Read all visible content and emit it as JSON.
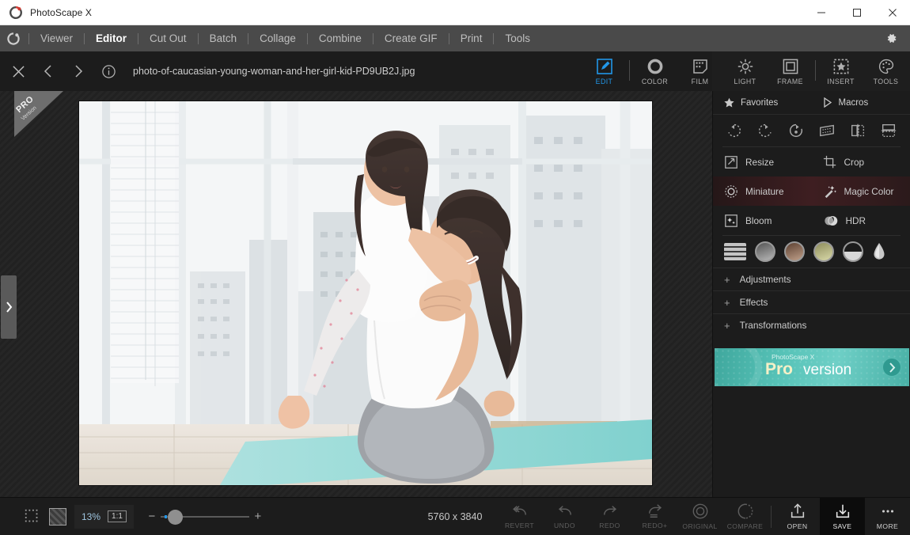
{
  "window": {
    "title": "PhotoScape X",
    "logo_icon": "photoscape-logo-icon",
    "minimize_icon": "minimize-icon",
    "maximize_icon": "maximize-icon",
    "close_icon": "close-icon"
  },
  "menubar": {
    "logo_icon": "photoscape-mark-icon",
    "items": [
      {
        "label": "Viewer",
        "active": false
      },
      {
        "label": "Editor",
        "active": true
      },
      {
        "label": "Cut Out",
        "active": false
      },
      {
        "label": "Batch",
        "active": false
      },
      {
        "label": "Collage",
        "active": false
      },
      {
        "label": "Combine",
        "active": false
      },
      {
        "label": "Create GIF",
        "active": false
      },
      {
        "label": "Print",
        "active": false
      },
      {
        "label": "Tools",
        "active": false
      }
    ],
    "settings_icon": "gear-icon"
  },
  "filebar": {
    "close_icon": "close-icon",
    "prev_icon": "chevron-left-icon",
    "next_icon": "chevron-right-icon",
    "info_icon": "info-icon",
    "filename": "photo-of-caucasian-young-woman-and-her-girl-kid-PD9UB2J.jpg"
  },
  "edit_tabs": [
    {
      "label": "EDIT",
      "icon": "edit-pencil-icon",
      "selected": true
    },
    {
      "label": "COLOR",
      "icon": "color-ring-icon",
      "selected": false
    },
    {
      "label": "FILM",
      "icon": "film-icon",
      "selected": false
    },
    {
      "label": "LIGHT",
      "icon": "light-sun-icon",
      "selected": false
    },
    {
      "label": "FRAME",
      "icon": "frame-square-icon",
      "selected": false
    },
    {
      "label": "INSERT",
      "icon": "insert-star-icon",
      "selected": false
    },
    {
      "label": "TOOLS",
      "icon": "tools-palette-icon",
      "selected": false
    }
  ],
  "canvas": {
    "pro_ribbon_line1": "PRO",
    "pro_ribbon_line2": "Version",
    "left_handle_icon": "chevron-right-icon"
  },
  "right_panel": {
    "favorites": {
      "label": "Favorites",
      "icon": "star-icon"
    },
    "macros": {
      "label": "Macros",
      "icon": "play-triangle-icon"
    },
    "transform_icons": [
      "rotate-left-icon",
      "rotate-right-icon",
      "free-rotate-icon",
      "skew-icon",
      "flip-horizontal-icon",
      "flip-vertical-icon"
    ],
    "tools": [
      [
        {
          "label": "Resize",
          "icon": "resize-icon",
          "highlighted": false
        },
        {
          "label": "Crop",
          "icon": "crop-icon",
          "highlighted": false
        }
      ],
      [
        {
          "label": "Miniature",
          "icon": "miniature-icon",
          "highlighted": true
        },
        {
          "label": "Magic Color",
          "icon": "magic-wand-icon",
          "highlighted": true
        }
      ],
      [
        {
          "label": "Bloom",
          "icon": "bloom-icon",
          "highlighted": false
        },
        {
          "label": "HDR",
          "icon": "hdr-icon",
          "highlighted": false
        }
      ]
    ],
    "filters": [
      {
        "name": "filter-list-icon",
        "color": "#c4c4c4"
      },
      {
        "name": "filter-grayscale-swatch",
        "color": "#8f9296"
      },
      {
        "name": "filter-sepia-swatch",
        "color": "#9c7a63"
      },
      {
        "name": "filter-vintage-swatch",
        "color": "#c7c79a"
      },
      {
        "name": "filter-vignette-swatch",
        "color": "#d8d8d8"
      },
      {
        "name": "filter-blur-drop-icon",
        "color": "#cfcfcf"
      }
    ],
    "accordions": [
      {
        "label": "Adjustments",
        "expander": "+"
      },
      {
        "label": "Effects",
        "expander": "+"
      },
      {
        "label": "Transformations",
        "expander": "+"
      }
    ],
    "pro_banner": {
      "small": "PhotoScape X",
      "pro": "Pro",
      "version": "version",
      "arrow_icon": "chevron-right-circle-icon",
      "accent": "#55c2b8"
    }
  },
  "bottombar": {
    "fit_icon": "fit-screen-icon",
    "checker_icon": "transparency-checker-icon",
    "zoom_percent": "13%",
    "actual_size_label": "1:1",
    "zoom_out_icon": "minus-icon",
    "zoom_in_icon": "plus-icon",
    "dimensions": "5760 x 3840",
    "actions": [
      {
        "label": "REVERT",
        "icon": "revert-icon",
        "enabled": false
      },
      {
        "label": "UNDO",
        "icon": "undo-icon",
        "enabled": false
      },
      {
        "label": "REDO",
        "icon": "redo-icon",
        "enabled": false
      },
      {
        "label": "REDO+",
        "icon": "redo-plus-icon",
        "enabled": false
      },
      {
        "label": "ORIGINAL",
        "icon": "original-circle-icon",
        "enabled": false
      },
      {
        "label": "COMPARE",
        "icon": "compare-icon",
        "enabled": false
      }
    ],
    "file_actions": [
      {
        "label": "OPEN",
        "icon": "open-upload-icon",
        "primary": false
      },
      {
        "label": "SAVE",
        "icon": "save-download-icon",
        "primary": true
      },
      {
        "label": "MORE",
        "icon": "more-dots-icon",
        "primary": false
      }
    ]
  },
  "colors": {
    "accent_blue": "#2196e8",
    "panel_bg": "#1c1c1c",
    "menu_bg": "#4a4a4a"
  }
}
